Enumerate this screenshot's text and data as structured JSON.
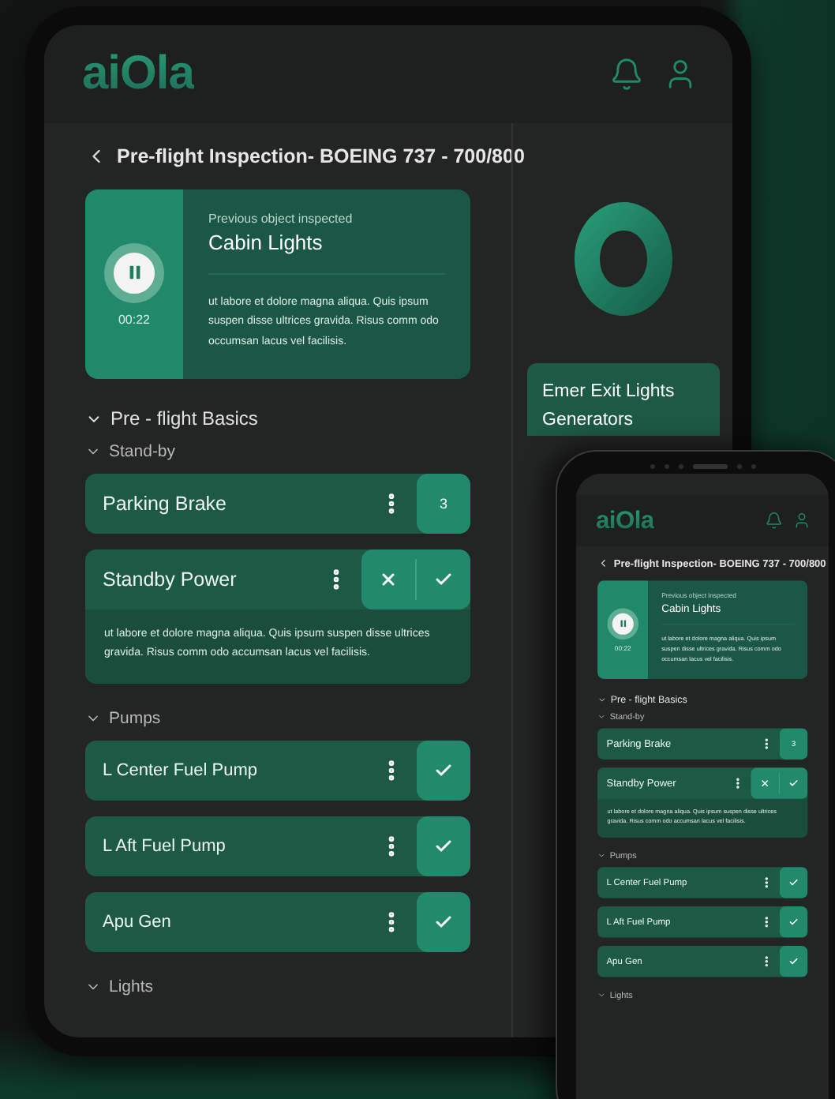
{
  "tablet": {
    "logo": "aiOla",
    "title": "Pre-flight Inspection- BOEING 737 - 700/800",
    "previous": {
      "caption": "Previous object inspected",
      "name": "Cabin Lights",
      "time": "00:22",
      "description": "ut labore et dolore magna aliqua. Quis ipsum suspen disse ultrices gravida. Risus comm odo occumsan lacus vel facilisis."
    },
    "section": {
      "title": "Pre - flight Basics",
      "children": [
        {
          "title": "Stand-by",
          "items": [
            {
              "kind": "count",
              "label": "Parking Brake",
              "value": "3"
            },
            {
              "kind": "decision",
              "label": "Standby Power",
              "description": "ut labore et dolore magna aliqua. Quis ipsum suspen disse ultrices gravida. Risus comm odo  accumsan lacus vel facilisis."
            }
          ]
        },
        {
          "title": "Pumps",
          "items": [
            {
              "kind": "check",
              "label": "L Center Fuel Pump"
            },
            {
              "kind": "check",
              "label": "L Aft Fuel Pump"
            },
            {
              "kind": "check",
              "label": "Apu Gen"
            }
          ]
        },
        {
          "title": "Lights"
        }
      ]
    },
    "side_card": {
      "title": "Emer Exit Lights Generators"
    }
  },
  "phone": {
    "logo": "aiOla",
    "title": "Pre-flight Inspection- BOEING 737 - 700/800",
    "previous": {
      "caption": "Previous object inspected",
      "name": "Cabin Lights",
      "time": "00:22",
      "description": "ut labore et dolore magna aliqua. Quis ipsum suspen disse ultrices gravida. Risus comm odo occumsan lacus vel facilisis."
    },
    "section": {
      "title": "Pre - flight Basics",
      "children": [
        {
          "title": "Stand-by",
          "items": [
            {
              "kind": "count",
              "label": "Parking Brake",
              "value": "3"
            },
            {
              "kind": "decision",
              "label": "Standby Power",
              "description": "ut labore et dolore magna aliqua. Quis ipsum suspen disse ultrices gravida. Risus comm odo  accumsan lacus vel facilisis."
            }
          ]
        },
        {
          "title": "Pumps",
          "items": [
            {
              "kind": "check",
              "label": "L Center Fuel Pump"
            },
            {
              "kind": "check",
              "label": "L Aft Fuel Pump"
            },
            {
              "kind": "check",
              "label": "Apu Gen"
            }
          ]
        },
        {
          "title": "Lights"
        }
      ]
    }
  }
}
